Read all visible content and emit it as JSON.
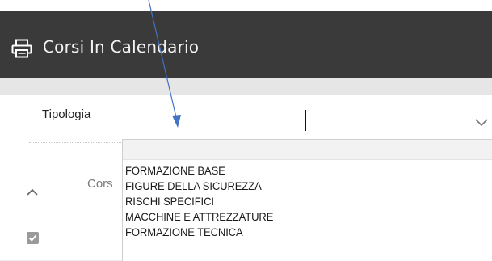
{
  "header": {
    "title": "Corsi In Calendario",
    "icon": "printer-icon"
  },
  "filter": {
    "label": "Tipologia",
    "value": ""
  },
  "table": {
    "column_label": "Cors"
  },
  "dropdown": {
    "options": [
      "",
      "FORMAZIONE BASE",
      "FIGURE DELLA SICUREZZA",
      "RISCHI SPECIFICI",
      "MACCHINE E ATTREZZATURE",
      "FORMAZIONE TECNICA"
    ]
  },
  "colors": {
    "header_bg": "#3a3a3a",
    "annotation_arrow": "#4472c4"
  }
}
